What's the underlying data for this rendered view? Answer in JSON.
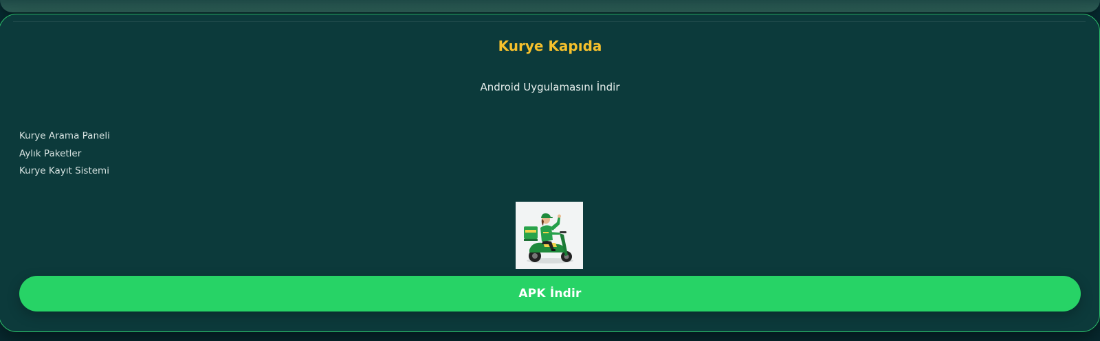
{
  "header": {
    "title": "Kurye Kapıda",
    "subtitle": "Android Uygulamasını İndir"
  },
  "menu": {
    "items": [
      {
        "label": "Kurye Arama Paneli"
      },
      {
        "label": "Aylık Paketler"
      },
      {
        "label": "Kurye Kayıt Sistemi"
      }
    ]
  },
  "hero": {
    "image_description": "courier-on-scooter"
  },
  "download": {
    "button_label": "APK İndir"
  },
  "colors": {
    "background": "#072a30",
    "card": "#0c3a3b",
    "card_border": "#2bbf6a",
    "title": "#f6c02c",
    "button": "#27d366",
    "text": "#d7e3e1"
  }
}
